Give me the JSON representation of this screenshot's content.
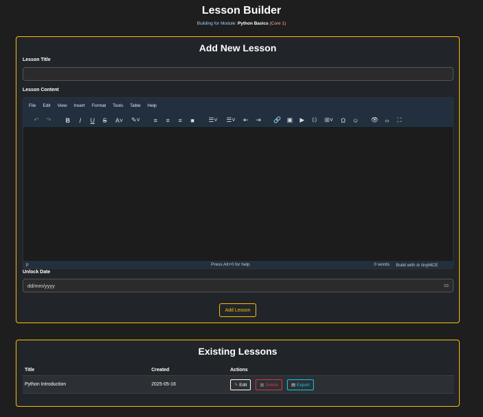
{
  "header": {
    "title": "Lesson Builder",
    "subtitle_prefix": "Building for Module:",
    "module_name": "Python Basics",
    "module_suffix": "(Core 1)"
  },
  "add_form": {
    "heading": "Add New Lesson",
    "title_label": "Lesson Title",
    "title_value": "",
    "content_label": "Lesson Content",
    "editor": {
      "menu": [
        "File",
        "Edit",
        "View",
        "Insert",
        "Format",
        "Tools",
        "Table",
        "Help"
      ],
      "status_path": "p",
      "help_text": "Press Alt+0 for help",
      "word_count": "0 words",
      "brand": "Build with ⊘ tinyMCE"
    },
    "date_label": "Unlock Date",
    "date_placeholder": "dd/mm/yyyy",
    "submit_label": "Add Lesson"
  },
  "existing": {
    "heading": "Existing Lessons",
    "columns": [
      "Title",
      "Created",
      "Actions"
    ],
    "rows": [
      {
        "title": "Python Introduction",
        "created": "2025-05-16"
      }
    ],
    "actions": {
      "edit": "Edit",
      "delete": "Delete",
      "export": "Export"
    }
  }
}
